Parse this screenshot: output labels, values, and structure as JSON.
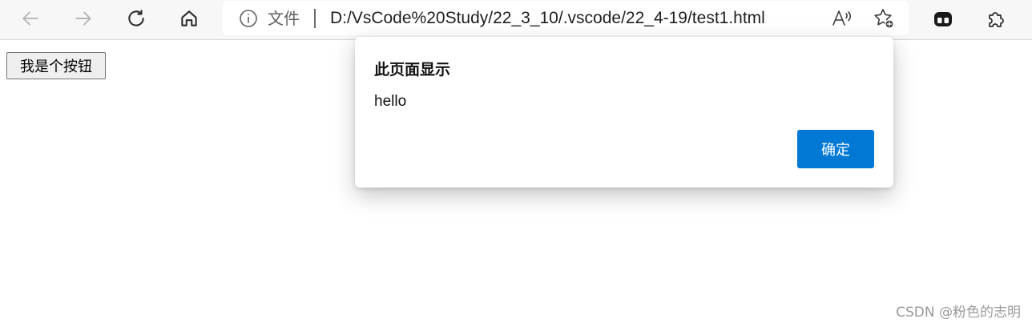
{
  "browser": {
    "address_bar": {
      "scheme_label": "文件",
      "url": "D:/VsCode%20Study/22_3_10/.vscode/22_4-19/test1.html"
    },
    "icons": {
      "back": "back-arrow-icon",
      "forward": "forward-arrow-icon",
      "refresh": "refresh-icon",
      "home": "home-icon",
      "info": "info-icon",
      "read_aloud": "read-aloud-icon",
      "favorite": "add-favorite-icon",
      "collections": "collections-icon",
      "extensions": "extensions-puzzle-icon"
    }
  },
  "page": {
    "button_label": "我是个按钮"
  },
  "dialog": {
    "title": "此页面显示",
    "message": "hello",
    "ok_label": "确定",
    "ok_color": "#0078d4"
  },
  "watermark": "CSDN @粉色的志明"
}
